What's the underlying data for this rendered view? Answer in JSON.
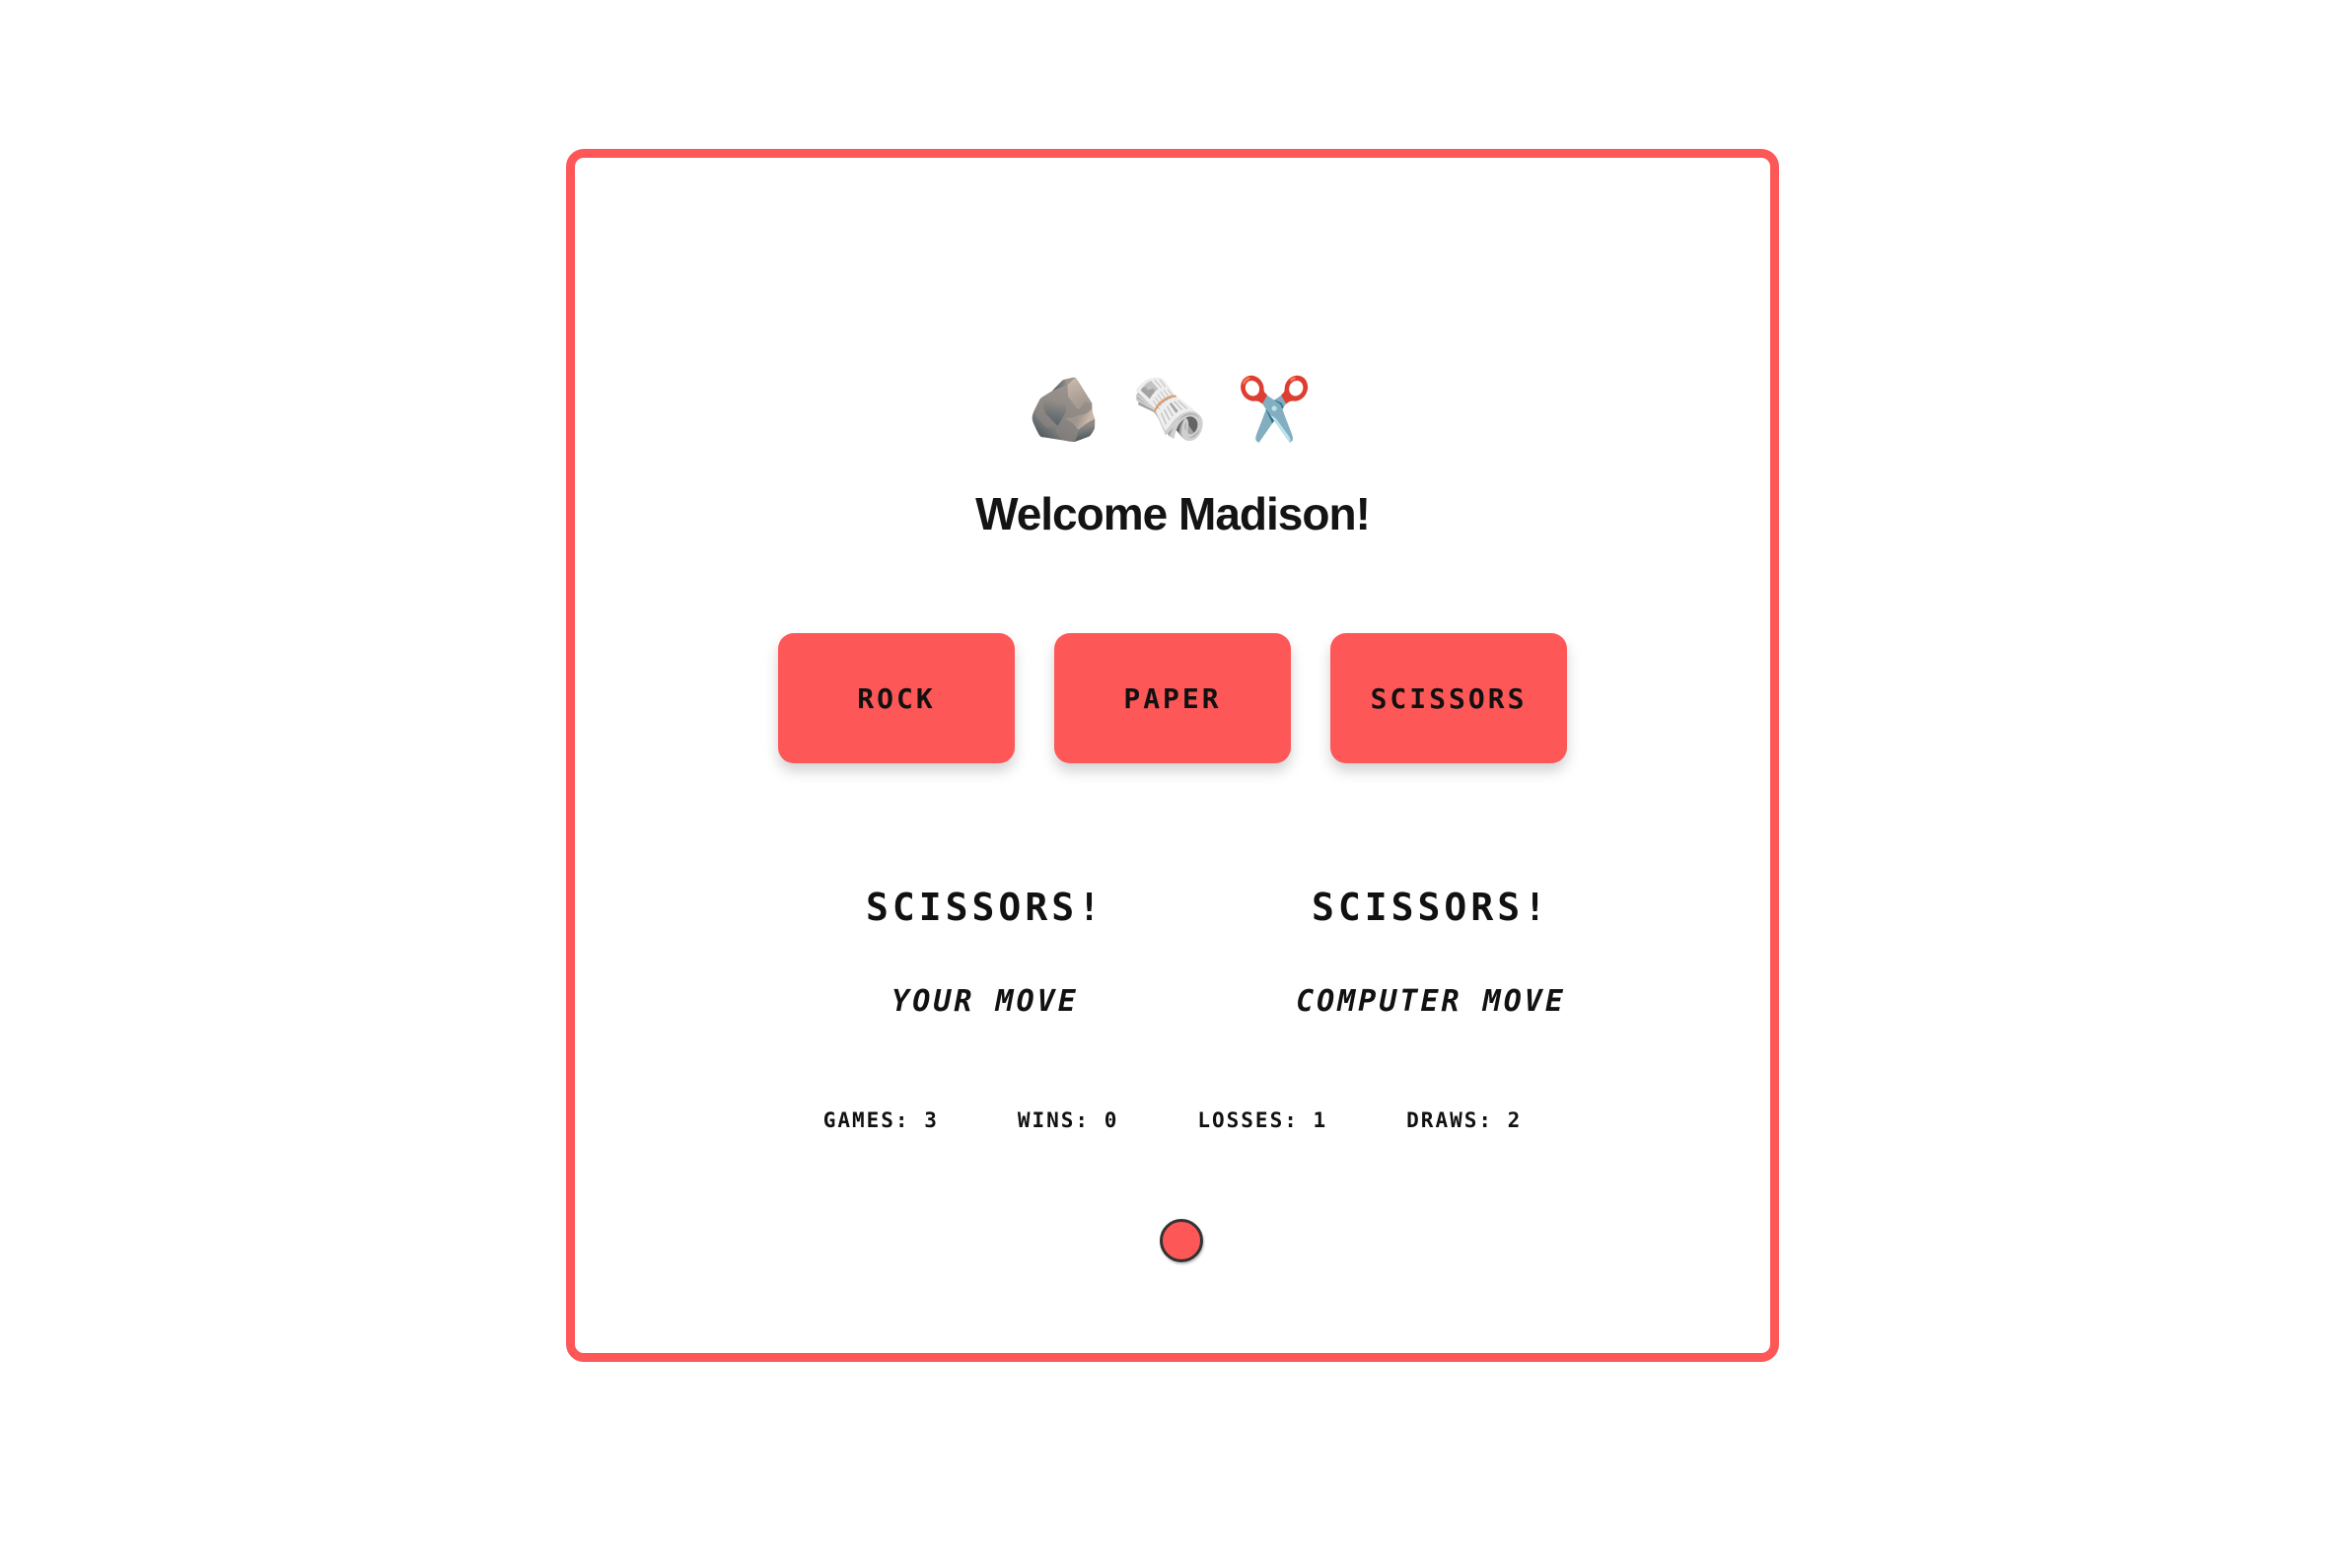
{
  "header": {
    "icons": [
      {
        "name": "rock-icon",
        "glyph": "🪨"
      },
      {
        "name": "newspaper-icon",
        "glyph": "🗞️"
      },
      {
        "name": "scissors-icon",
        "glyph": "✂️"
      }
    ],
    "welcome": "Welcome Madison!"
  },
  "buttons": {
    "rock": "ROCK",
    "paper": "PAPER",
    "scissors": "SCISSORS"
  },
  "result": {
    "player_move": "SCISSORS!",
    "player_label": "YOUR MOVE",
    "computer_move": "SCISSORS!",
    "computer_label": "COMPUTER MOVE"
  },
  "stats": {
    "games": "GAMES: 3",
    "wins": "WINS: 0",
    "losses": "LOSSES: 1",
    "draws": "DRAWS: 2"
  },
  "colors": {
    "accent": "#fe5757",
    "text": "#111111",
    "background": "#ffffff"
  }
}
